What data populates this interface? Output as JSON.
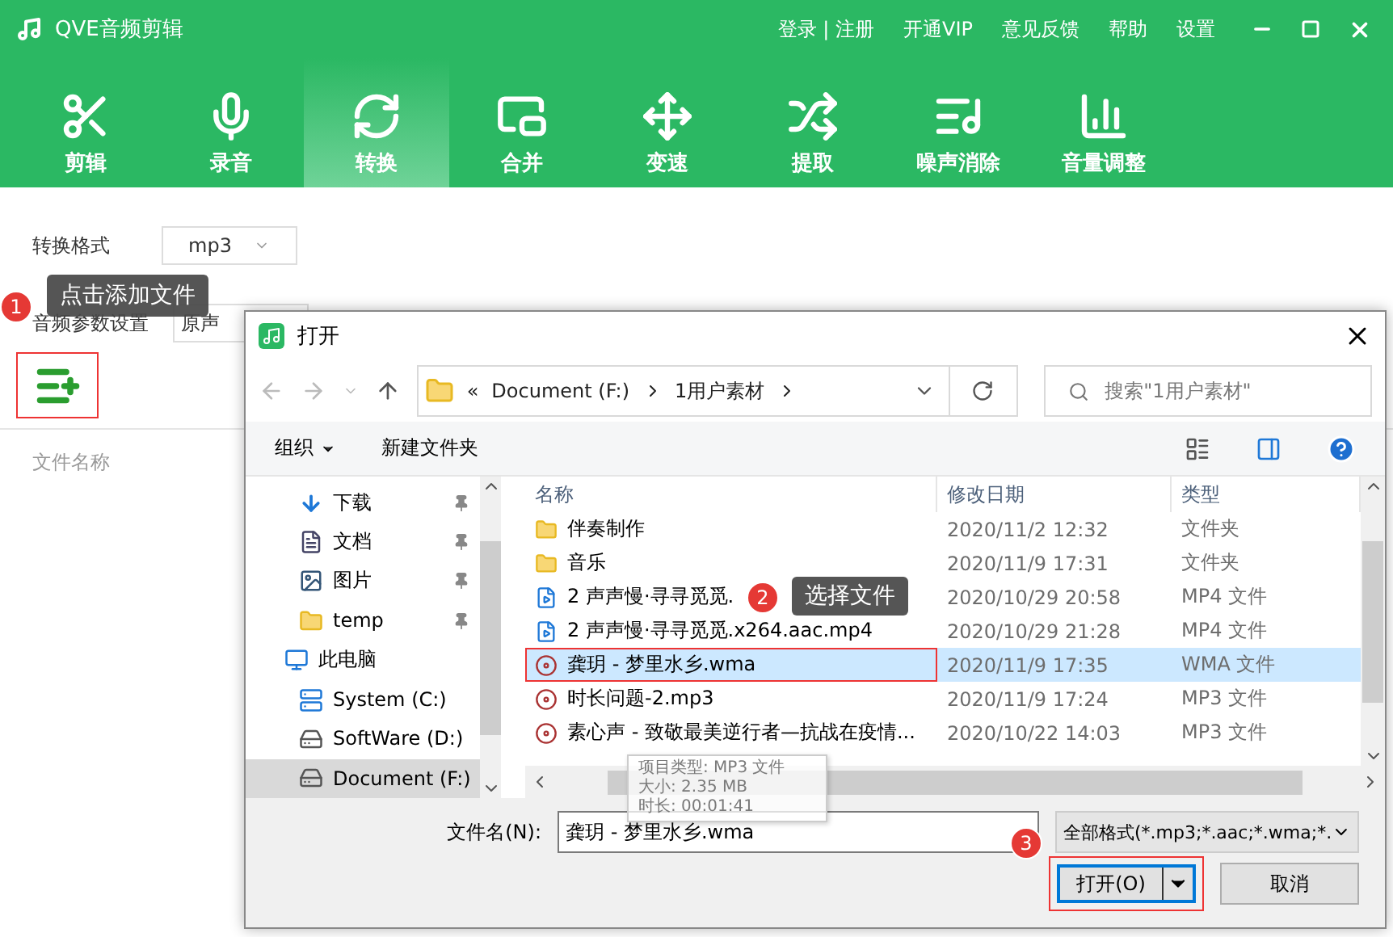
{
  "app": {
    "title": "QVE音频剪辑",
    "links": [
      "登录 | 注册",
      "开通VIP",
      "意见反馈",
      "帮助",
      "设置"
    ]
  },
  "tabs": [
    {
      "label": "剪辑",
      "kind": "scissors",
      "selected": false
    },
    {
      "label": "录音",
      "kind": "mic",
      "selected": false
    },
    {
      "label": "转换",
      "kind": "convert",
      "selected": true
    },
    {
      "label": "合并",
      "kind": "merge",
      "selected": false
    },
    {
      "label": "变速",
      "kind": "speed",
      "selected": false
    },
    {
      "label": "提取",
      "kind": "extract",
      "selected": false
    },
    {
      "label": "噪声消除",
      "kind": "denoise",
      "selected": false
    },
    {
      "label": "音量调整",
      "kind": "volume",
      "selected": false
    }
  ],
  "settings": {
    "format_label": "转换格式",
    "format_value": "mp3",
    "params_label": "音频参数设置",
    "params_value": "原声"
  },
  "file_list_header": "文件名称",
  "hints": [
    {
      "badge": "1",
      "text": "点击添加文件"
    },
    {
      "badge": "2",
      "text": "选择文件"
    },
    {
      "badge": "3"
    }
  ],
  "dialog": {
    "title": "打开",
    "path": [
      "Document (F:)",
      "1用户素材"
    ],
    "path_prefix": "«",
    "search_placeholder": "搜索\"1用户素材\"",
    "toolbar": {
      "organize": "组织",
      "new_folder": "新建文件夹"
    },
    "nav": [
      {
        "label": "下载",
        "kind": "download",
        "pinned": true,
        "selected": false
      },
      {
        "label": "文档",
        "kind": "document",
        "pinned": true,
        "selected": false
      },
      {
        "label": "图片",
        "kind": "image",
        "pinned": true,
        "selected": false
      },
      {
        "label": "temp",
        "kind": "folder",
        "pinned": true,
        "selected": false
      },
      {
        "label": "此电脑",
        "kind": "pc",
        "pinned": false,
        "selected": false
      },
      {
        "label": "System (C:)",
        "kind": "system-drive",
        "pinned": false,
        "selected": false
      },
      {
        "label": "SoftWare (D:)",
        "kind": "drive",
        "pinned": false,
        "selected": false
      },
      {
        "label": "Document (F:)",
        "kind": "drive",
        "pinned": false,
        "selected": true
      }
    ],
    "columns": [
      "名称",
      "修改日期",
      "类型"
    ],
    "files": [
      {
        "name": "伴奏制作",
        "date": "2020/11/2 12:32",
        "type": "文件夹",
        "kind": "folder",
        "selected": false
      },
      {
        "name": "音乐",
        "date": "2020/11/9 17:31",
        "type": "文件夹",
        "kind": "folder",
        "selected": false
      },
      {
        "name": "2 声声慢·寻寻觅觅.",
        "date": "2020/10/29 20:58",
        "type": "MP4 文件",
        "kind": "video",
        "selected": false
      },
      {
        "name": "2 声声慢·寻寻觅觅.x264.aac.mp4",
        "date": "2020/10/29 21:28",
        "type": "MP4 文件",
        "kind": "video",
        "selected": false
      },
      {
        "name": "龚玥 - 梦里水乡.wma",
        "date": "2020/11/9 17:35",
        "type": "WMA 文件",
        "kind": "audio",
        "selected": true
      },
      {
        "name": "时长问题-2.mp3",
        "date": "2020/11/9 17:24",
        "type": "MP3 文件",
        "kind": "audio",
        "selected": false
      },
      {
        "name": "素心声 - 致敬最美逆行者—抗战在疫情...",
        "date": "2020/10/22 14:03",
        "type": "MP3 文件",
        "kind": "audio",
        "selected": false
      }
    ],
    "file_tip": [
      "项目类型: MP3 文件",
      "大小: 2.35 MB",
      "时长: 00:01:41"
    ],
    "filename_label": "文件名(N):",
    "filename_value": "龚玥 - 梦里水乡.wma",
    "filter": "全部格式(*.mp3;*.aac;*.wma;*.",
    "open_button": "打开(O)",
    "cancel_button": "取消"
  }
}
